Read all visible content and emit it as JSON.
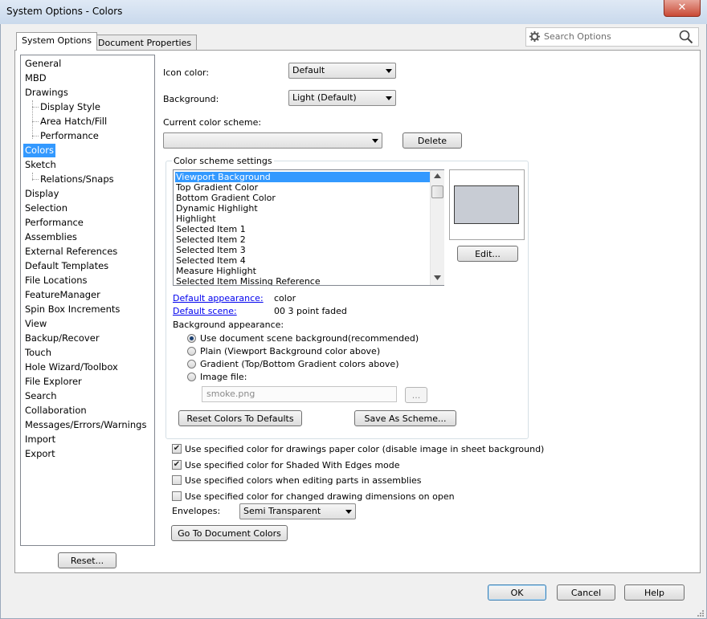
{
  "window": {
    "title": "System Options - Colors",
    "close_icon": "✕"
  },
  "tabs": [
    {
      "label": "System Options"
    },
    {
      "label": "Document Properties"
    }
  ],
  "search": {
    "placeholder": "Search Options"
  },
  "tree": {
    "items": [
      {
        "label": "General"
      },
      {
        "label": "MBD"
      },
      {
        "label": "Drawings"
      },
      {
        "label": "Display Style"
      },
      {
        "label": "Area Hatch/Fill"
      },
      {
        "label": "Performance"
      },
      {
        "label": "Colors"
      },
      {
        "label": "Sketch"
      },
      {
        "label": "Relations/Snaps"
      },
      {
        "label": "Display"
      },
      {
        "label": "Selection"
      },
      {
        "label": "Performance"
      },
      {
        "label": "Assemblies"
      },
      {
        "label": "External References"
      },
      {
        "label": "Default Templates"
      },
      {
        "label": "File Locations"
      },
      {
        "label": "FeatureManager"
      },
      {
        "label": "Spin Box Increments"
      },
      {
        "label": "View"
      },
      {
        "label": "Backup/Recover"
      },
      {
        "label": "Touch"
      },
      {
        "label": "Hole Wizard/Toolbox"
      },
      {
        "label": "File Explorer"
      },
      {
        "label": "Search"
      },
      {
        "label": "Collaboration"
      },
      {
        "label": "Messages/Errors/Warnings"
      },
      {
        "label": "Import"
      },
      {
        "label": "Export"
      }
    ],
    "selected": "Colors",
    "reset_label": "Reset..."
  },
  "colors": {
    "icon_color_label": "Icon color:",
    "icon_color_value": "Default",
    "background_label": "Background:",
    "background_value": "Light (Default)",
    "scheme_label": "Current color scheme:",
    "scheme_value": "",
    "delete_label": "Delete",
    "settings_title": "Color scheme settings",
    "scheme_items": [
      "Viewport Background",
      "Top Gradient Color",
      "Bottom Gradient Color",
      "Dynamic Highlight",
      "Highlight",
      "Selected Item 1",
      "Selected Item 2",
      "Selected Item 3",
      "Selected Item 4",
      "Measure Highlight",
      "Selected Item Missing Reference"
    ],
    "swatch_color": "#c8ccd4",
    "edit_label": "Edit...",
    "default_appearance_label": "Default appearance:",
    "default_appearance_value": "color",
    "default_scene_label": "Default scene:",
    "default_scene_value": "00 3 point faded",
    "bg_appearance_label": "Background appearance:",
    "bg_options": [
      {
        "label": "Use document scene background(recommended)",
        "checked": true
      },
      {
        "label": "Plain (Viewport Background color above)",
        "checked": false
      },
      {
        "label": "Gradient (Top/Bottom Gradient colors above)",
        "checked": false
      },
      {
        "label": "Image file:",
        "checked": false
      }
    ],
    "image_file_value": "smoke.png",
    "browse_label": "...",
    "reset_colors_label": "Reset Colors To Defaults",
    "save_scheme_label": "Save As Scheme...",
    "checkboxes": [
      {
        "label": "Use specified color for drawings paper color (disable image in sheet background)",
        "checked": true
      },
      {
        "label": "Use specified color for Shaded With Edges mode",
        "checked": true
      },
      {
        "label": "Use specified colors when editing parts in assemblies",
        "checked": false
      },
      {
        "label": "Use specified color for changed drawing dimensions on open",
        "checked": false
      }
    ],
    "envelopes_label": "Envelopes:",
    "envelopes_value": "Semi Transparent",
    "goto_doc_colors_label": "Go To Document Colors"
  },
  "footer": {
    "ok_label": "OK",
    "cancel_label": "Cancel",
    "help_label": "Help"
  }
}
